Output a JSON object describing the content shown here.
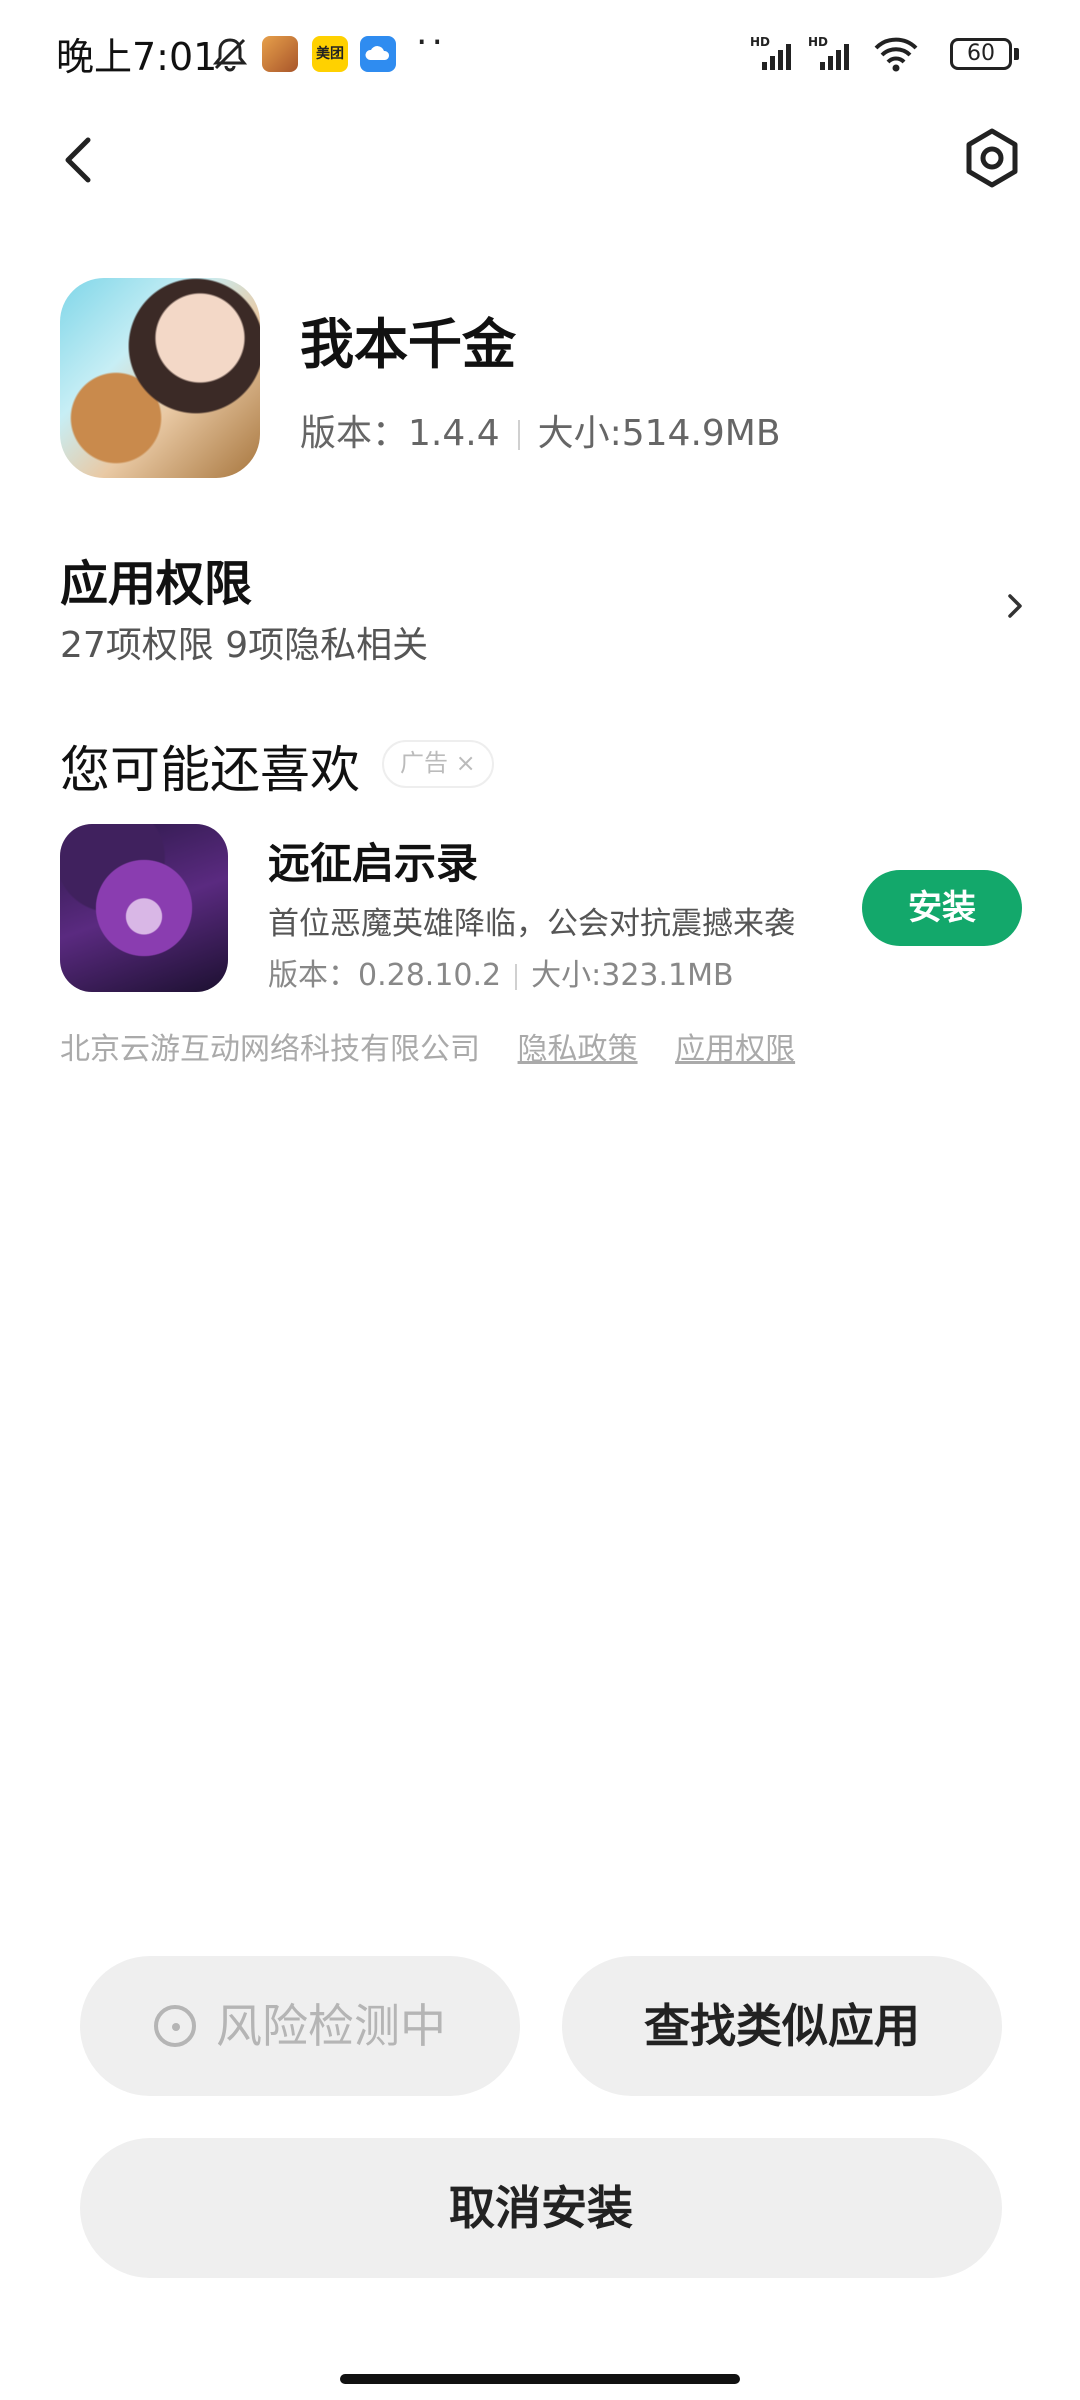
{
  "status_bar": {
    "time": "晚上7:01",
    "notif_app_label": "美团",
    "battery": "60"
  },
  "nav": {
    "back_icon": "chevron-left-icon",
    "settings_icon": "settings-gear-icon"
  },
  "app": {
    "name": "我本千金",
    "version": "版本：1.4.4",
    "size": "大小:514.9MB"
  },
  "permissions": {
    "title": "应用权限",
    "summary": "27项权限 9项隐私相关"
  },
  "recommendation": {
    "section_title": "您可能还喜欢",
    "ad_label": "广告",
    "ad_close": "×",
    "item": {
      "name": "远征启示录",
      "description": "首位恶魔英雄降临，公会对抗震撼来袭",
      "version": "版本：0.28.10.2",
      "size": "大小:323.1MB",
      "install_label": "安装"
    },
    "developer": "北京云游互动网络科技有限公司",
    "privacy_link": "隐私政策",
    "permissions_link": "应用权限"
  },
  "actions": {
    "risk_check": "风险检测中",
    "find_similar": "查找类似应用",
    "cancel_install": "取消安装"
  },
  "colors": {
    "install_green": "#13a86b",
    "button_gray": "#efefef"
  }
}
